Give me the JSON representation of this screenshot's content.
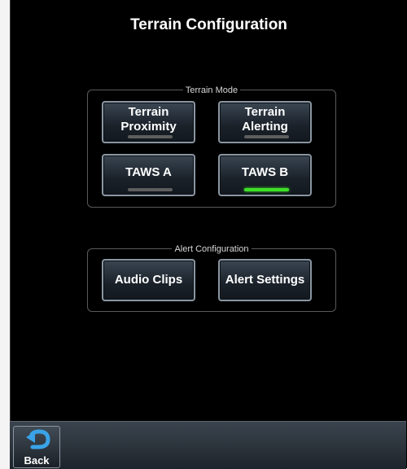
{
  "screen": {
    "title": "Terrain Configuration"
  },
  "terrain_mode": {
    "label": "Terrain Mode",
    "buttons": [
      {
        "line1": "Terrain",
        "line2": "Proximity",
        "active": false
      },
      {
        "line1": "Terrain",
        "line2": "Alerting",
        "active": false
      },
      {
        "label": "TAWS A",
        "active": false
      },
      {
        "label": "TAWS B",
        "active": true
      }
    ]
  },
  "alert_config": {
    "label": "Alert Configuration",
    "buttons": [
      {
        "label": "Audio Clips"
      },
      {
        "label": "Alert Settings"
      }
    ]
  },
  "bottom_bar": {
    "back_label": "Back",
    "back_icon": "back-arrow-icon"
  },
  "colors": {
    "indicator_on": "#3ee028",
    "indicator_off": "#5e5e5e",
    "background": "#000000"
  }
}
